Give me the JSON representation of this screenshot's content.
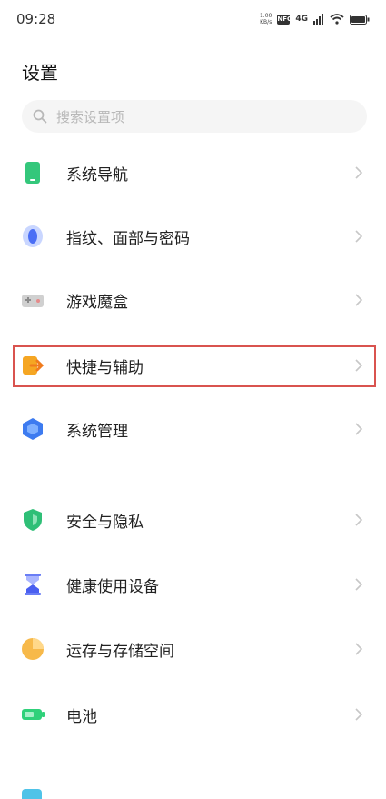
{
  "status": {
    "time": "09:28",
    "speed_top": "1.00",
    "speed_unit": "KB/s",
    "nfc": "NFC",
    "network": "4G"
  },
  "page_title": "设置",
  "search": {
    "placeholder": "搜索设置项"
  },
  "items": [
    {
      "label": "系统导航",
      "icon": "phone-nav-icon"
    },
    {
      "label": "指纹、面部与密码",
      "icon": "fingerprint-icon"
    },
    {
      "label": "游戏魔盒",
      "icon": "game-box-icon"
    },
    {
      "label": "快捷与辅助",
      "icon": "shortcut-icon"
    },
    {
      "label": "系统管理",
      "icon": "system-management-icon"
    },
    {
      "label": "安全与隐私",
      "icon": "shield-icon"
    },
    {
      "label": "健康使用设备",
      "icon": "hourglass-icon"
    },
    {
      "label": "运存与存储空间",
      "icon": "storage-pie-icon"
    },
    {
      "label": "电池",
      "icon": "battery-icon"
    }
  ],
  "colors": {
    "highlight": "#d9534f",
    "green": "#34c77b",
    "blue": "#4a7bf7",
    "orange": "#f5a623"
  }
}
